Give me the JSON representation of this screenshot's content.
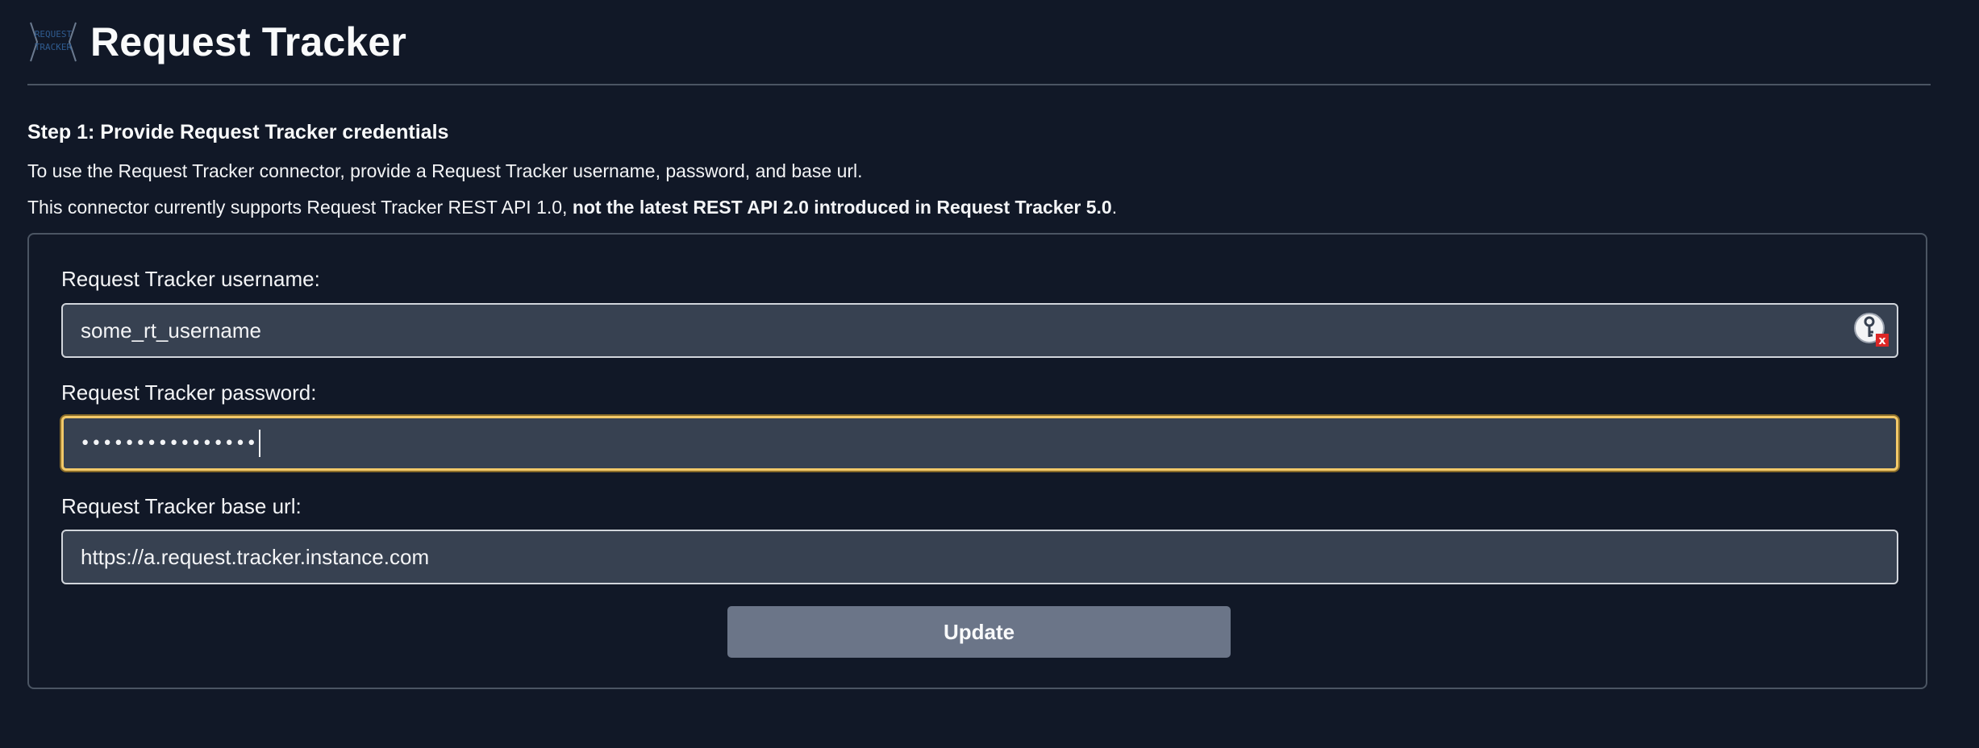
{
  "header": {
    "title": "Request Tracker",
    "logo_icon": "request-tracker-logo"
  },
  "step": {
    "title": "Step 1: Provide Request Tracker credentials",
    "description": "To use the Request Tracker connector, provide a Request Tracker username, password, and base url.",
    "note_prefix": "This connector currently supports Request Tracker REST API 1.0, ",
    "note_bold": "not the latest REST API 2.0 introduced in Request Tracker 5.0",
    "note_suffix": "."
  },
  "form": {
    "username_label": "Request Tracker username:",
    "username_value": "some_rt_username",
    "password_label": "Request Tracker password:",
    "password_masked": "••••••••••••••••",
    "base_url_label": "Request Tracker base url:",
    "base_url_value": "https://a.request.tracker.instance.com",
    "update_label": "Update"
  },
  "colors": {
    "background": "#111827",
    "input_background": "#374151",
    "focus_ring": "#f3c969",
    "button": "#6b7588"
  }
}
